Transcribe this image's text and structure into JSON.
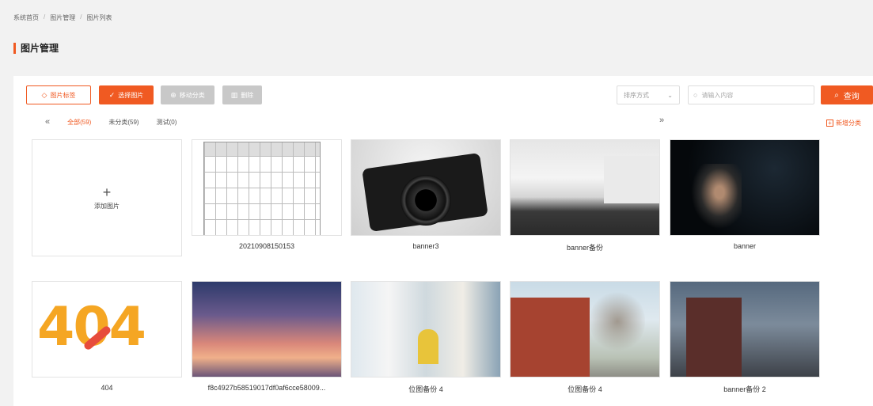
{
  "breadcrumb": {
    "items": [
      "系统首页",
      "图片管理",
      "图片列表"
    ],
    "separator": "/"
  },
  "page_title": "图片管理",
  "toolbar": {
    "group_label": "图片标签",
    "select_label": "选择图片",
    "move_label": "移动分类",
    "delete_label": "删除"
  },
  "sort": {
    "label": "排序方式"
  },
  "search": {
    "placeholder": "请输入内容",
    "button_label": "查询"
  },
  "tabs": [
    {
      "label": "全部(59)",
      "active": true
    },
    {
      "label": "未分类(59)",
      "active": false
    },
    {
      "label": "测试(0)",
      "active": false
    }
  ],
  "add_category_label": "新增分类",
  "add_image_label": "添加图片",
  "images": [
    {
      "caption": "20210908150153"
    },
    {
      "caption": "banner3"
    },
    {
      "caption": "banner备份"
    },
    {
      "caption": "banner"
    },
    {
      "caption": "404"
    },
    {
      "caption": "f8c4927b58519017df0af6cce58009..."
    },
    {
      "caption": "位图备份 4"
    },
    {
      "caption": "位图备份 4"
    },
    {
      "caption": "banner备份 2"
    }
  ],
  "colors": {
    "accent": "#f05a22",
    "disabled": "#c8c8c8"
  }
}
